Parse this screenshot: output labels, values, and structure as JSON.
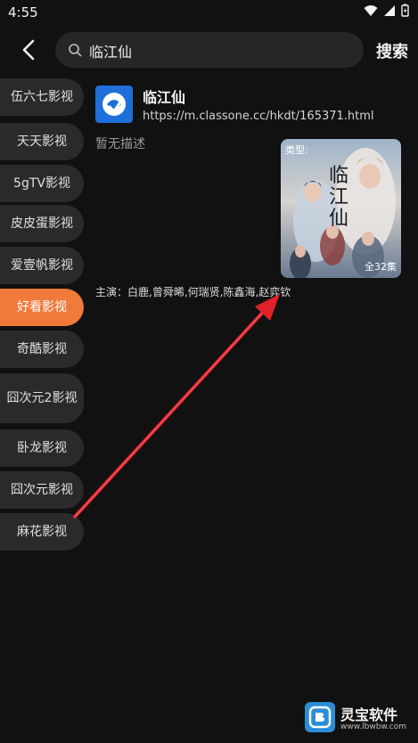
{
  "status": {
    "time": "4:55"
  },
  "search": {
    "query": "临江仙",
    "submit_label": "搜索"
  },
  "sidebar": {
    "items": [
      {
        "label": "伍六七影视"
      },
      {
        "label": "天天影视"
      },
      {
        "label": "5gTV影视"
      },
      {
        "label": "皮皮蛋影视"
      },
      {
        "label": "爱壹帆影视"
      },
      {
        "label": "好看影视",
        "active": true
      },
      {
        "label": "奇酷影视"
      },
      {
        "label": "囧次元2影视"
      },
      {
        "label": "卧龙影视"
      },
      {
        "label": "囧次元影视"
      },
      {
        "label": "麻花影视"
      }
    ]
  },
  "result": {
    "title": "临江仙",
    "url": "https://m.classone.cc/hkdt/165371.html",
    "description": "暂无描述",
    "poster_tag": "类型:",
    "poster_title": "临江仙",
    "episodes": "全32集",
    "cast": "主演：白鹿,曾舜晞,何瑞贤,陈鑫海,赵弈钦"
  },
  "watermark": {
    "name": "灵宝软件",
    "url": "www.lbwbw.com"
  },
  "colors": {
    "accent": "#f07a3a",
    "background": "#111111",
    "arrow": "#e0202a"
  }
}
